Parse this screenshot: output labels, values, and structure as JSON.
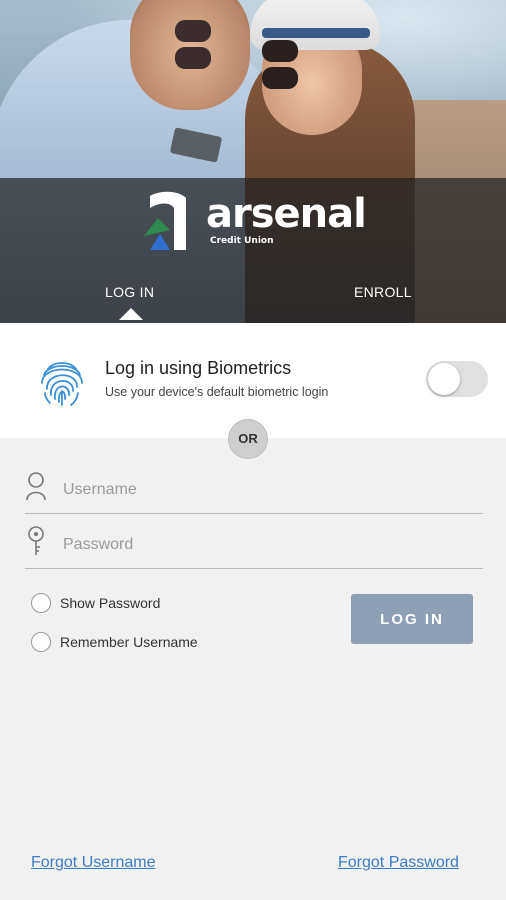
{
  "brand": {
    "name": "arsenal",
    "subtitle": "Credit Union"
  },
  "tabs": {
    "login_label": "LOG IN",
    "enroll_label": "ENROLL"
  },
  "biometrics": {
    "title": "Log in using Biometrics",
    "subtitle": "Use your device's default biometric login",
    "enabled": false
  },
  "divider": {
    "label": "OR"
  },
  "form": {
    "username_placeholder": "Username",
    "username_value": "",
    "password_placeholder": "Password",
    "password_value": "",
    "show_password_label": "Show Password",
    "remember_username_label": "Remember Username",
    "login_button_label": "LOG IN"
  },
  "links": {
    "forgot_username": "Forgot Username",
    "forgot_password": "Forgot Password"
  },
  "colors": {
    "accent_link": "#3d7cc4",
    "login_button": "#8fa0b4",
    "logo_green": "#2f8a52",
    "logo_blue": "#2e6fd0"
  }
}
